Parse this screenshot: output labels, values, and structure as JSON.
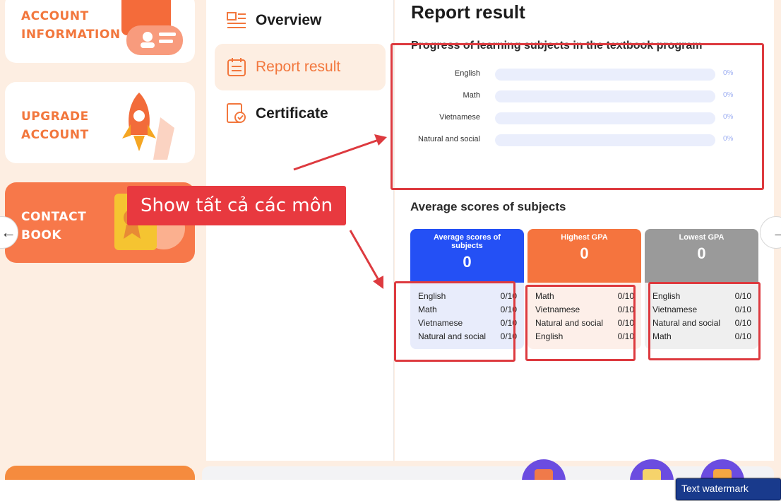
{
  "sidebar": {
    "account_label": "ACCOUNT\nINFORMATION",
    "upgrade_label": "UPGRADE\nACCOUNT",
    "contact_label": "CONTACT\nBOOK"
  },
  "nav": {
    "items": [
      {
        "label": "Overview",
        "icon": "overview-icon"
      },
      {
        "label": "Report result",
        "icon": "calendar-icon",
        "active": true
      },
      {
        "label": "Certificate",
        "icon": "certificate-icon"
      }
    ]
  },
  "report": {
    "title": "Report result",
    "progress_title": "Progress of learning subjects in the textbook program",
    "progress": [
      {
        "subject": "English",
        "percent_label": "0%",
        "value": 0
      },
      {
        "subject": "Math",
        "percent_label": "0%",
        "value": 0
      },
      {
        "subject": "Vietnamese",
        "percent_label": "0%",
        "value": 0
      },
      {
        "subject": "Natural and social",
        "percent_label": "0%",
        "value": 0
      }
    ],
    "avg_title": "Average scores of subjects",
    "cards": [
      {
        "title": "Average scores of subjects",
        "value": "0",
        "color": "#2450f5",
        "rows": [
          {
            "subject": "English",
            "score": "0/10"
          },
          {
            "subject": "Math",
            "score": "0/10"
          },
          {
            "subject": "Vietnamese",
            "score": "0/10"
          },
          {
            "subject": "Natural and social",
            "score": "0/10"
          }
        ]
      },
      {
        "title": "Highest GPA",
        "value": "0",
        "color": "#f5743e",
        "rows": [
          {
            "subject": "Math",
            "score": "0/10"
          },
          {
            "subject": "Vietnamese",
            "score": "0/10"
          },
          {
            "subject": "Natural and social",
            "score": "0/10"
          },
          {
            "subject": "English",
            "score": "0/10"
          }
        ]
      },
      {
        "title": "Lowest GPA",
        "value": "0",
        "color": "#9a9a9a",
        "rows": [
          {
            "subject": "English",
            "score": "0/10"
          },
          {
            "subject": "Vietnamese",
            "score": "0/10"
          },
          {
            "subject": "Natural and social",
            "score": "0/10"
          },
          {
            "subject": "Math",
            "score": "0/10"
          }
        ]
      }
    ]
  },
  "annotation": {
    "callout": "Show tất cả các môn",
    "color": "#dd3a3f"
  },
  "controls": {
    "prev_icon": "arrow-left-icon",
    "next_icon": "arrow-right-icon"
  },
  "watermark": "Text watermark"
}
